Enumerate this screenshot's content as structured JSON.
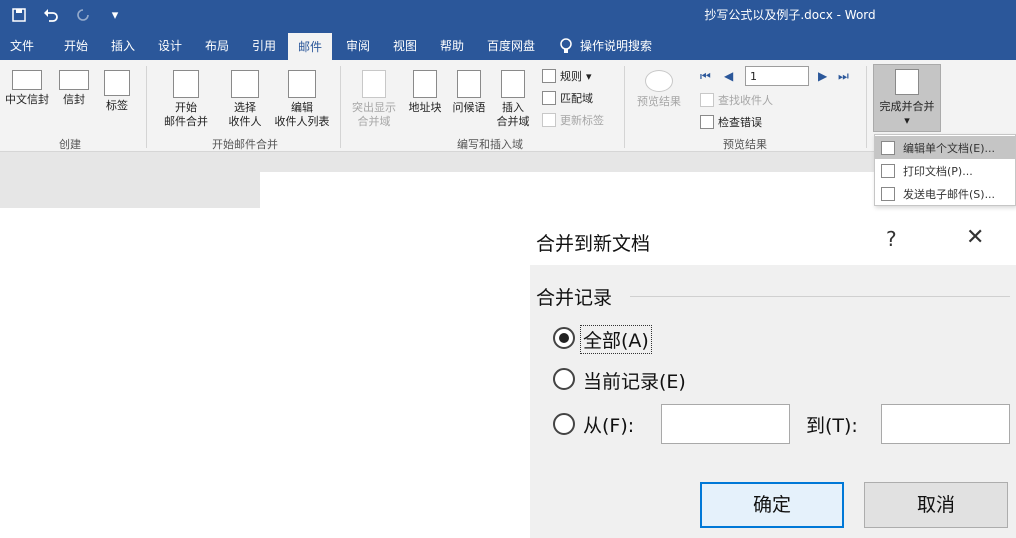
{
  "window": {
    "title": "抄写公式以及例子.docx - Word",
    "qat": {
      "save_icon": "save-icon",
      "undo_icon": "undo-icon",
      "redo_icon": "redo-icon"
    }
  },
  "tabs": [
    {
      "label": "文件"
    },
    {
      "label": "开始"
    },
    {
      "label": "插入"
    },
    {
      "label": "设计"
    },
    {
      "label": "布局"
    },
    {
      "label": "引用"
    },
    {
      "label": "邮件"
    },
    {
      "label": "审阅"
    },
    {
      "label": "视图"
    },
    {
      "label": "帮助"
    },
    {
      "label": "百度网盘"
    }
  ],
  "tell_me": "操作说明搜索",
  "ribbon": {
    "create": {
      "label": "创建",
      "chinese_envelope": "中文信封",
      "envelope": "信封",
      "labels": "标签"
    },
    "start_merge": {
      "label": "开始邮件合并",
      "start_line1": "开始",
      "start_line2": "邮件合并",
      "select_line1": "选择",
      "select_line2": "收件人",
      "edit_line1": "编辑",
      "edit_line2": "收件人列表"
    },
    "write_insert": {
      "label": "编写和插入域",
      "highlight_line1": "突出显示",
      "highlight_line2": "合并域",
      "address_block": "地址块",
      "greeting_line": "问候语",
      "insert_line1": "插入",
      "insert_line2": "合并域",
      "rules": "规则",
      "match_fields": "匹配域",
      "update_labels": "更新标签"
    },
    "preview": {
      "label": "预览结果",
      "preview_results": "预览结果",
      "record": "1",
      "find_recipient": "查找收件人",
      "check_errors": "检查错误"
    },
    "finish": {
      "label": "完成并合并"
    }
  },
  "menu": {
    "items": [
      {
        "label": "编辑单个文档(E)..."
      },
      {
        "label": "打印文档(P)..."
      },
      {
        "label": "发送电子邮件(S)..."
      }
    ]
  },
  "dialog": {
    "title": "合并到新文档",
    "help": "?",
    "close": "✕",
    "group_label": "合并记录",
    "option_all": "全部(A)",
    "option_current": "当前记录(E)",
    "option_from": "从(F):",
    "to_label": "到(T):",
    "from_value": "",
    "to_value": "",
    "ok": "确定",
    "cancel": "取消"
  }
}
